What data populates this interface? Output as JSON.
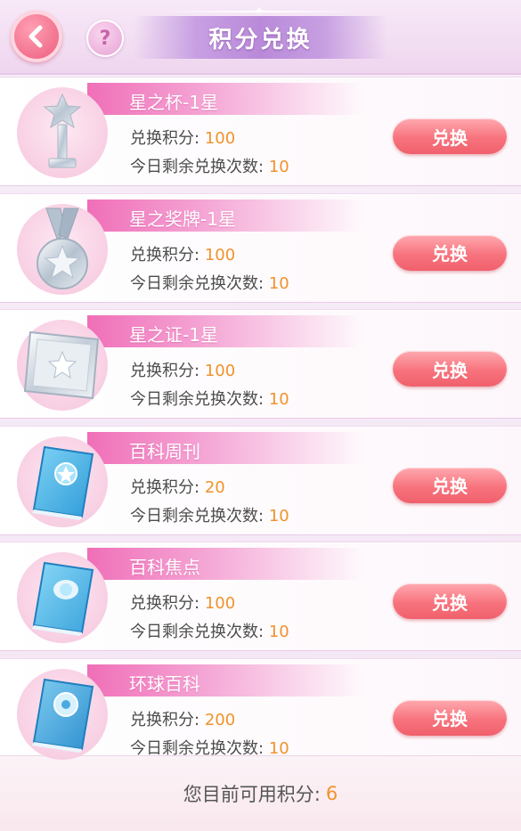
{
  "header": {
    "back_icon": "chevron-left-icon",
    "help_label": "?",
    "title": "积分兑换"
  },
  "labels": {
    "points_label": "兑换积分:",
    "remaining_label": "今日剩余兑换次数:"
  },
  "items": [
    {
      "name": "星之杯-1星",
      "points": "100",
      "remaining": "10",
      "button": "兑换",
      "icon": "trophy-icon"
    },
    {
      "name": "星之奖牌-1星",
      "points": "100",
      "remaining": "10",
      "button": "兑换",
      "icon": "medal-icon"
    },
    {
      "name": "星之证-1星",
      "points": "100",
      "remaining": "10",
      "button": "兑换",
      "icon": "certificate-icon"
    },
    {
      "name": "百科周刊",
      "points": "20",
      "remaining": "10",
      "button": "兑换",
      "icon": "book-icon"
    },
    {
      "name": "百科焦点",
      "points": "100",
      "remaining": "10",
      "button": "兑换",
      "icon": "book-icon"
    },
    {
      "name": "环球百科",
      "points": "200",
      "remaining": "10",
      "button": "兑换",
      "icon": "book-icon"
    }
  ],
  "footer": {
    "label": "您目前可用积分:",
    "value": "6"
  },
  "colors": {
    "accent_orange": "#f1922c",
    "button_pink": "#f7737d",
    "banner_pink": "#f06fb8",
    "title_purple": "#b98ad9"
  }
}
